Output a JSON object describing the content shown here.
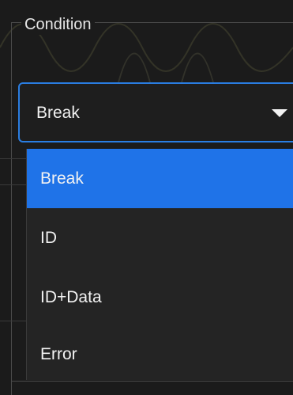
{
  "condition": {
    "legend": "Condition",
    "selected_value": "Break",
    "options": [
      {
        "label": "Break",
        "selected": true
      },
      {
        "label": "ID",
        "selected": false
      },
      {
        "label": "ID+Data",
        "selected": false
      },
      {
        "label": "Error",
        "selected": false
      }
    ]
  },
  "colors": {
    "background": "#1b1b1b",
    "accent": "#1f73e8",
    "focus_border": "#2a7de1",
    "text": "#f2f2f2"
  },
  "icons": {
    "dropdown_caret": "caret-down-icon"
  }
}
